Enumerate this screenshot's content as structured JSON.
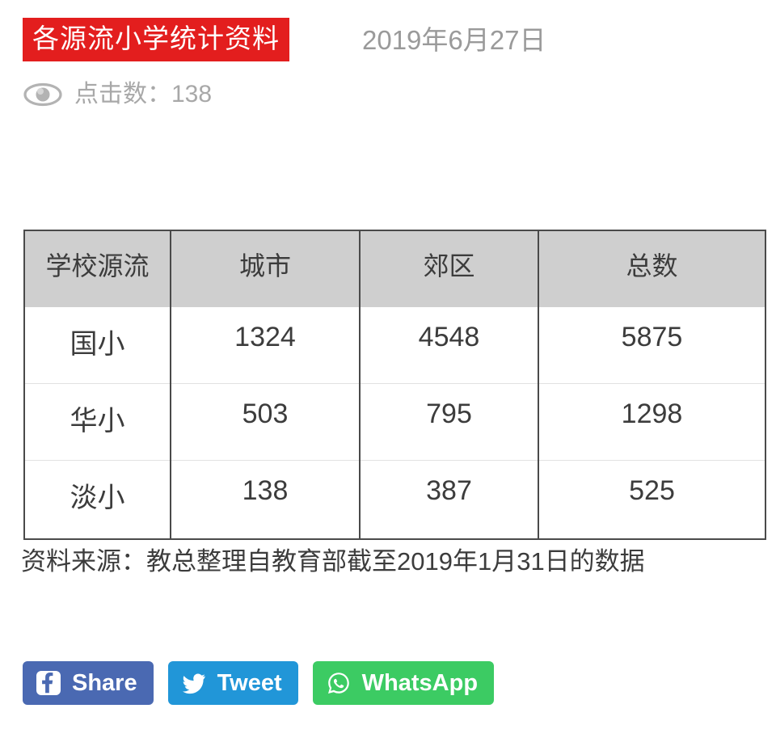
{
  "header": {
    "title": "各源流小学统计资料",
    "title_bg_color": "#e31e1e",
    "date": "2019年6月27日",
    "hits_icon": "eye-icon",
    "hits_text": "点击数：138",
    "hits_count": 138
  },
  "chart_data": {
    "type": "table",
    "title": "各源流小学统计资料",
    "columns": [
      "学校源流",
      "城市",
      "郊区",
      "总数"
    ],
    "rows": [
      {
        "source": "国小",
        "urban": 1324,
        "suburban": 4548,
        "total": 5875
      },
      {
        "source": "华小",
        "urban": 503,
        "suburban": 795,
        "total": 1298
      },
      {
        "source": "淡小",
        "urban": 138,
        "suburban": 387,
        "total": 525
      }
    ],
    "cells": [
      [
        "国小",
        "1324",
        "4548",
        "5875"
      ],
      [
        "华小",
        "503",
        "795",
        "1298"
      ],
      [
        "淡小",
        "138",
        "387",
        "525"
      ]
    ],
    "header_bg": "#cfcfcf",
    "note": "资料来源：教总整理自教育部截至2019年1月31日的数据"
  },
  "table": {
    "headers": [
      "学校源流",
      "城市",
      "郊区",
      "总数"
    ],
    "rows": [
      [
        "国小",
        "1324",
        "4548",
        "5875"
      ],
      [
        "华小",
        "503",
        "795",
        "1298"
      ],
      [
        "淡小",
        "138",
        "387",
        "525"
      ]
    ]
  },
  "source_note": "资料来源：教总整理自教育部截至2019年1月31日的数据",
  "share": {
    "buttons": [
      {
        "label": "Share",
        "icon": "facebook-icon",
        "color": "#4a69b2"
      },
      {
        "label": "Tweet",
        "icon": "twitter-icon",
        "color": "#2196d8"
      },
      {
        "label": "WhatsApp",
        "icon": "whatsapp-icon",
        "color": "#3ccb63"
      }
    ]
  }
}
